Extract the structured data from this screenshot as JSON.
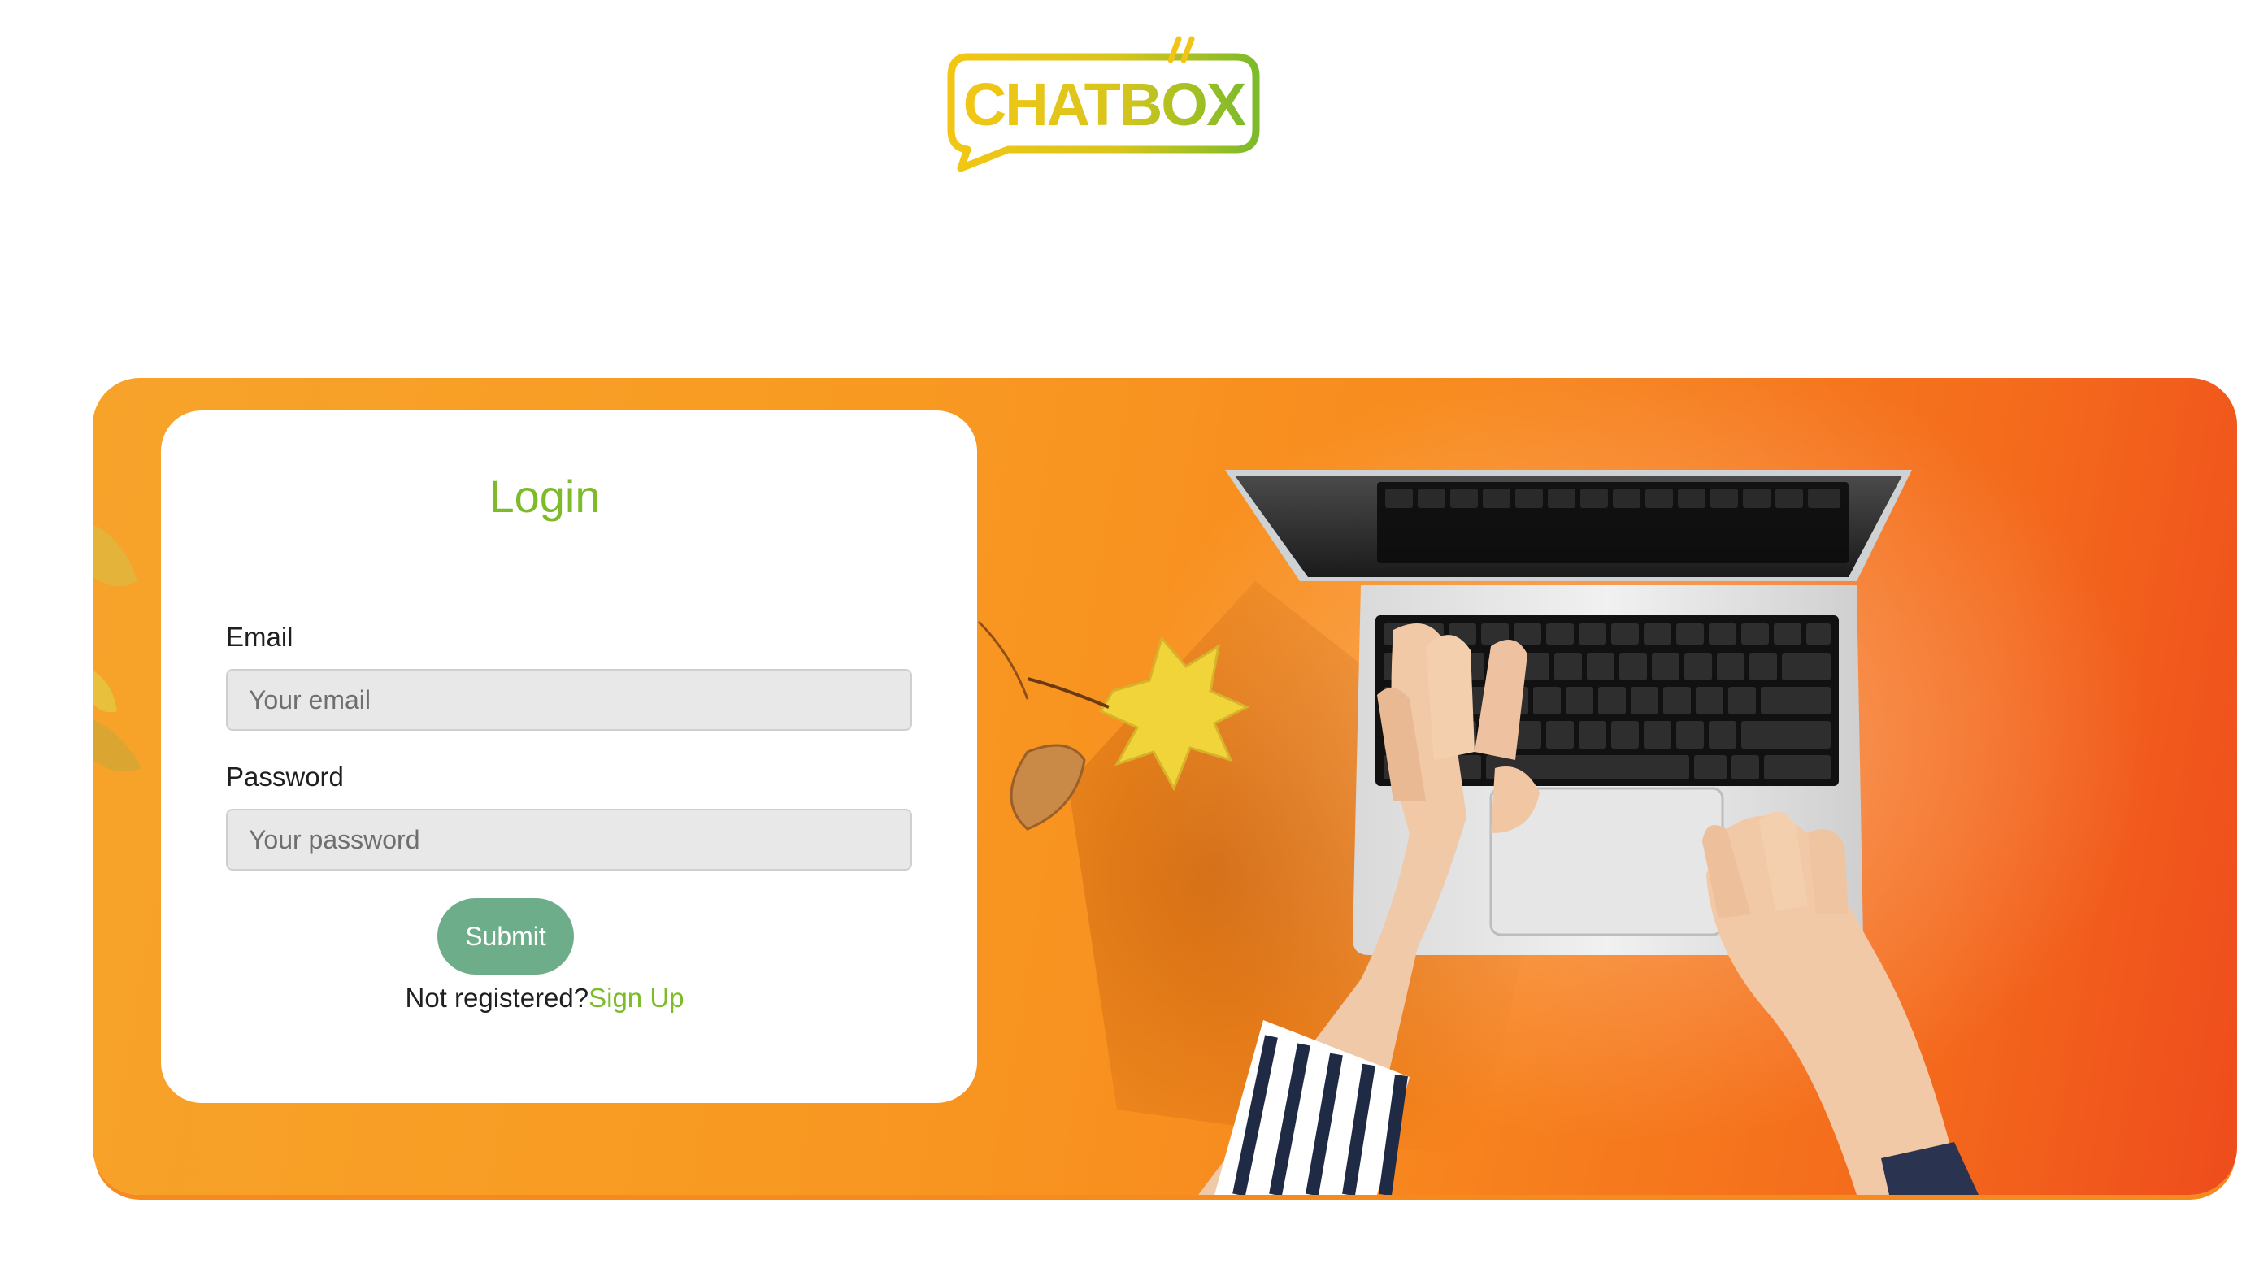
{
  "brand": {
    "logo_text": "CHATBOX"
  },
  "login": {
    "title": "Login",
    "email_label": "Email",
    "email_placeholder": "Your email",
    "email_value": "",
    "password_label": "Password",
    "password_placeholder": "Your password",
    "password_value": "",
    "submit_label": "Submit",
    "signup_prompt": "Not registered?",
    "signup_link": "Sign Up"
  },
  "colors": {
    "accent_green": "#7dbb2a",
    "submit_button": "#6ead8a",
    "hero_orange": "#f89a22",
    "hero_red": "#ee4c1c",
    "logo_yellow": "#f2c418"
  }
}
